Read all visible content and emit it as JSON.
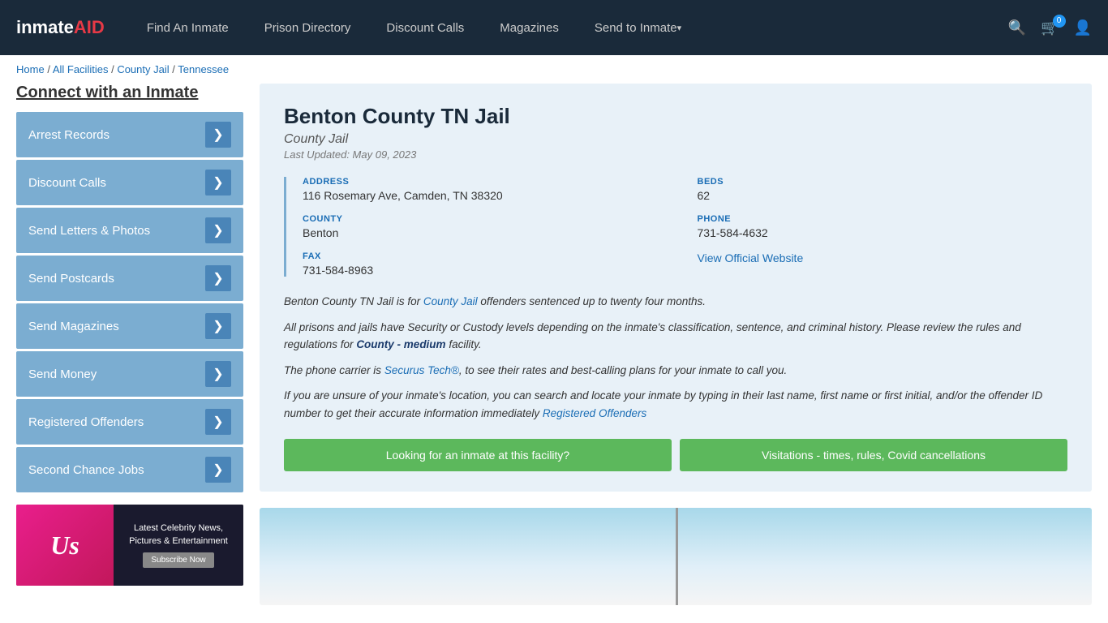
{
  "nav": {
    "logo": "inmateAID",
    "links": [
      {
        "label": "Find An Inmate",
        "id": "find-inmate",
        "dropdown": false
      },
      {
        "label": "Prison Directory",
        "id": "prison-directory",
        "dropdown": false
      },
      {
        "label": "Discount Calls",
        "id": "discount-calls",
        "dropdown": false
      },
      {
        "label": "Magazines",
        "id": "magazines",
        "dropdown": false
      },
      {
        "label": "Send to Inmate",
        "id": "send-to-inmate",
        "dropdown": true
      }
    ],
    "cart_count": "0",
    "search_title": "Search"
  },
  "breadcrumb": {
    "home": "Home",
    "separator1": " / ",
    "all_facilities": "All Facilities",
    "separator2": " / ",
    "county_jail": "County Jail",
    "separator3": " / ",
    "state": "Tennessee"
  },
  "sidebar": {
    "title": "Connect with an Inmate",
    "items": [
      {
        "label": "Arrest Records",
        "id": "arrest-records"
      },
      {
        "label": "Discount Calls",
        "id": "discount-calls"
      },
      {
        "label": "Send Letters & Photos",
        "id": "send-letters"
      },
      {
        "label": "Send Postcards",
        "id": "send-postcards"
      },
      {
        "label": "Send Magazines",
        "id": "send-magazines"
      },
      {
        "label": "Send Money",
        "id": "send-money"
      },
      {
        "label": "Registered Offenders",
        "id": "registered-offenders"
      },
      {
        "label": "Second Chance Jobs",
        "id": "second-chance-jobs"
      }
    ],
    "ad": {
      "logo": "Us",
      "text": "Latest Celebrity News, Pictures & Entertainment",
      "button": "Subscribe Now"
    }
  },
  "facility": {
    "name": "Benton County TN Jail",
    "type": "County Jail",
    "last_updated": "Last Updated: May 09, 2023",
    "address_label": "ADDRESS",
    "address_value": "116 Rosemary Ave, Camden, TN 38320",
    "beds_label": "BEDS",
    "beds_value": "62",
    "county_label": "COUNTY",
    "county_value": "Benton",
    "phone_label": "PHONE",
    "phone_value": "731-584-4632",
    "fax_label": "FAX",
    "fax_value": "731-584-8963",
    "website_label": "View Official Website",
    "website_url": "#",
    "desc1": "Benton County TN Jail is for County Jail offenders sentenced up to twenty four months.",
    "desc2": "All prisons and jails have Security or Custody levels depending on the inmate's classification, sentence, and criminal history. Please review the rules and regulations for County - medium facility.",
    "desc3": "The phone carrier is Securus Tech®, to see their rates and best-calling plans for your inmate to call you.",
    "desc4": "If you are unsure of your inmate's location, you can search and locate your inmate by typing in their last name, first name or first initial, and/or the offender ID number to get their accurate information immediately Registered Offenders",
    "btn1": "Looking for an inmate at this facility?",
    "btn2": "Visitations - times, rules, Covid cancellations"
  }
}
